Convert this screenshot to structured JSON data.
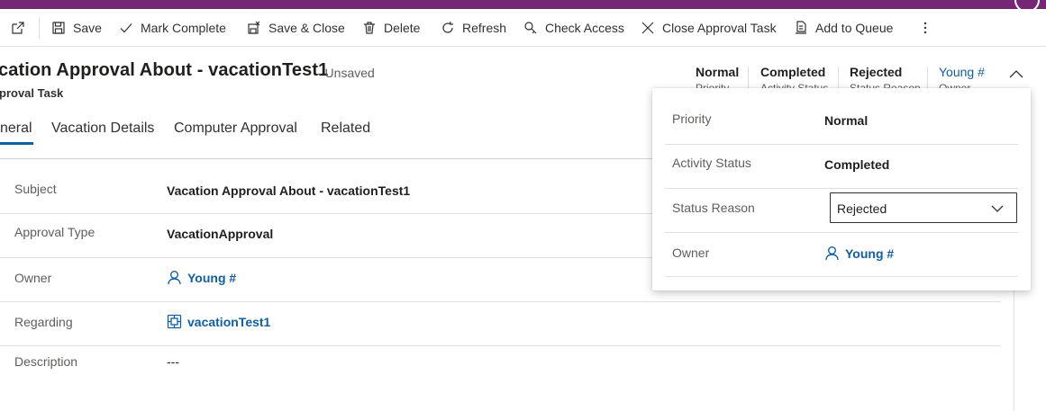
{
  "toolbar": {
    "save": "Save",
    "mark_complete": "Mark Complete",
    "save_close": "Save & Close",
    "delete": "Delete",
    "refresh": "Refresh",
    "check_access": "Check Access",
    "close_approval_task": "Close Approval Task",
    "add_to_queue": "Add to Queue"
  },
  "record": {
    "title": "cation Approval About - vacationTest1",
    "unsaved": "- Unsaved",
    "entity": "proval Task"
  },
  "header_fields": [
    {
      "value": "Normal",
      "label": "Priority"
    },
    {
      "value": "Completed",
      "label": "Activity Status"
    },
    {
      "value": "Rejected",
      "label": "Status Reason"
    },
    {
      "value": "Young #",
      "label": "Owner"
    }
  ],
  "tabs": {
    "general": "neral",
    "vacation_details": "Vacation Details",
    "computer_approval": "Computer Approval",
    "related": "Related"
  },
  "form": {
    "subject": {
      "label": "Subject",
      "value": "Vacation Approval About - vacationTest1"
    },
    "approval_type": {
      "label": "Approval Type",
      "value": "VacationApproval"
    },
    "owner": {
      "label": "Owner",
      "value": "Young #"
    },
    "regarding": {
      "label": "Regarding",
      "value": "vacationTest1"
    },
    "description": {
      "label": "Description",
      "value": "---"
    }
  },
  "flyout": {
    "priority": {
      "label": "Priority",
      "value": "Normal"
    },
    "activity_status": {
      "label": "Activity Status",
      "value": "Completed"
    },
    "status_reason": {
      "label": "Status Reason",
      "value": "Rejected"
    },
    "owner": {
      "label": "Owner",
      "value": "Young #"
    }
  },
  "colors": {
    "brand_bar": "#742774",
    "link": "#115ea3",
    "tab_underline": "#115ea3"
  },
  "icons": [
    "popout-icon",
    "save-icon",
    "checkmark-icon",
    "save-close-icon",
    "delete-icon",
    "refresh-icon",
    "check-access-icon",
    "close-icon",
    "add-to-queue-icon",
    "more-icon",
    "chevron-up-icon",
    "person-icon",
    "record-icon",
    "chevron-down-icon"
  ]
}
